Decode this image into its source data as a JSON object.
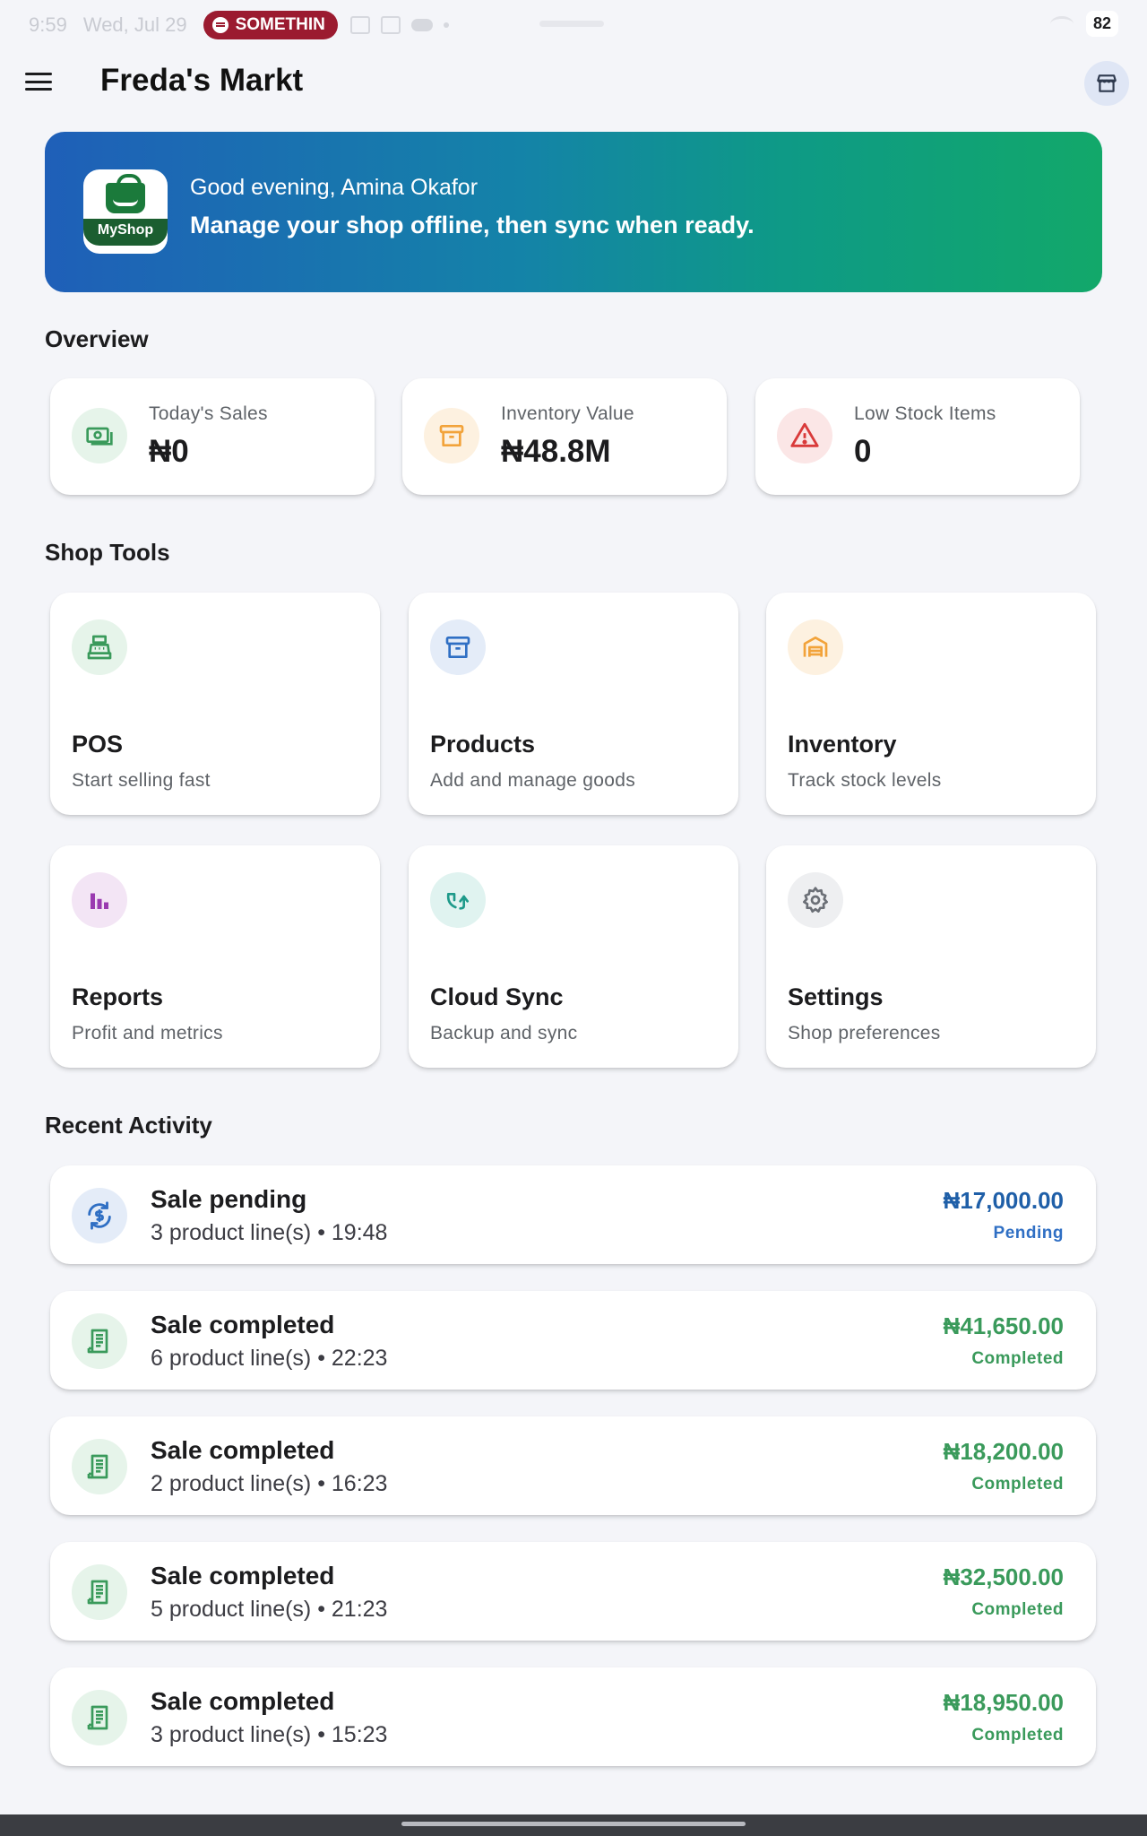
{
  "status_bar": {
    "time": "9:59",
    "date": "Wed, Jul 29",
    "spotify_label": "SOMETHIN",
    "battery": "82"
  },
  "app_bar": {
    "title": "Freda's Markt"
  },
  "hero": {
    "logo_text": "MyShop",
    "greeting": "Good evening, Amina Okafor",
    "tagline": "Manage your shop offline, then sync when ready."
  },
  "overview": {
    "title": "Overview",
    "cards": [
      {
        "label": "Today's Sales",
        "value": "₦0",
        "icon": "cash-icon",
        "color": "#3a9a5b",
        "bg": "#e6f4ea"
      },
      {
        "label": "Inventory Value",
        "value": "₦48.8M",
        "icon": "archive-icon",
        "color": "#f2a33a",
        "bg": "#fdf1e0"
      },
      {
        "label": "Low Stock Items",
        "value": "0",
        "icon": "warning-icon",
        "color": "#d93a3a",
        "bg": "#fbe6e6"
      }
    ]
  },
  "tools": {
    "title": "Shop Tools",
    "items": [
      {
        "title": "POS",
        "subtitle": "Start selling fast",
        "icon": "cash-register-icon",
        "color": "#3a9a5b",
        "bg": "#e6f4ea"
      },
      {
        "title": "Products",
        "subtitle": "Add and manage goods",
        "icon": "archive-icon",
        "color": "#2f6fc4",
        "bg": "#e4ecf8"
      },
      {
        "title": "Inventory",
        "subtitle": "Track stock levels",
        "icon": "warehouse-icon",
        "color": "#f2a33a",
        "bg": "#fdf1e0"
      },
      {
        "title": "Reports",
        "subtitle": "Profit and metrics",
        "icon": "bar-chart-icon",
        "color": "#9a3ab0",
        "bg": "#f3e5f5"
      },
      {
        "title": "Cloud Sync",
        "subtitle": "Backup and sync",
        "icon": "sync-icon",
        "color": "#1e9a8a",
        "bg": "#e0f3f0"
      },
      {
        "title": "Settings",
        "subtitle": "Shop preferences",
        "icon": "gear-icon",
        "color": "#6b6f76",
        "bg": "#eeeff1"
      }
    ]
  },
  "activity": {
    "title": "Recent Activity",
    "items": [
      {
        "title": "Sale pending",
        "subtitle": "3 product line(s) • 19:48",
        "amount": "₦17,000.00",
        "status": "Pending",
        "color": "#2f6fc4",
        "bg": "#e4ecf8",
        "icon": "sync-icon"
      },
      {
        "title": "Sale completed",
        "subtitle": "6 product line(s) • 22:23",
        "amount": "₦41,650.00",
        "status": "Completed",
        "color": "#3a9a5b",
        "bg": "#e6f4ea",
        "icon": "receipt-icon"
      },
      {
        "title": "Sale completed",
        "subtitle": "2 product line(s) • 16:23",
        "amount": "₦18,200.00",
        "status": "Completed",
        "color": "#3a9a5b",
        "bg": "#e6f4ea",
        "icon": "receipt-icon"
      },
      {
        "title": "Sale completed",
        "subtitle": "5 product line(s) • 21:23",
        "amount": "₦32,500.00",
        "status": "Completed",
        "color": "#3a9a5b",
        "bg": "#e6f4ea",
        "icon": "receipt-icon"
      },
      {
        "title": "Sale completed",
        "subtitle": "3 product line(s) • 15:23",
        "amount": "₦18,950.00",
        "status": "Completed",
        "color": "#3a9a5b",
        "bg": "#e6f4ea",
        "icon": "receipt-icon"
      }
    ]
  }
}
